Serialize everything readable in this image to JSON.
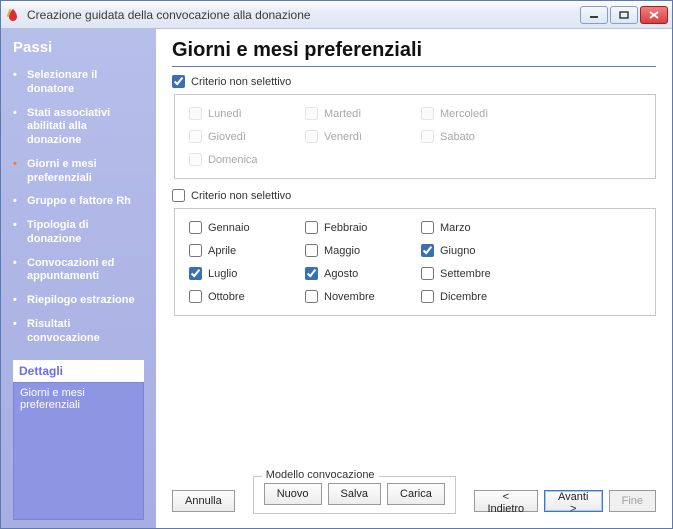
{
  "window": {
    "title": "Creazione guidata della convocazione alla donazione"
  },
  "sidebar": {
    "heading": "Passi",
    "steps": [
      "Selezionare il donatore",
      "Stati associativi abilitati alla donazione",
      "Giorni e mesi preferenziali",
      "Gruppo e fattore Rh",
      "Tipologia di donazione",
      "Convocazioni ed appuntamenti",
      "Riepilogo estrazione",
      "Risultati convocazione"
    ],
    "current_index": 2,
    "details_heading": "Dettagli",
    "details_text": "Giorni e mesi preferenziali"
  },
  "main": {
    "title": "Giorni e mesi preferenziali",
    "days_group": {
      "selective_label": "Criterio non selettivo",
      "selective_checked": true,
      "items": [
        {
          "label": "Lunedì",
          "checked": false
        },
        {
          "label": "Martedì",
          "checked": false
        },
        {
          "label": "Mercoledì",
          "checked": false
        },
        {
          "label": "Giovedì",
          "checked": false
        },
        {
          "label": "Venerdì",
          "checked": false
        },
        {
          "label": "Sabato",
          "checked": false
        },
        {
          "label": "Domenica",
          "checked": false
        }
      ]
    },
    "months_group": {
      "selective_label": "Criterio non selettivo",
      "selective_checked": false,
      "items": [
        {
          "label": "Gennaio",
          "checked": false
        },
        {
          "label": "Febbraio",
          "checked": false
        },
        {
          "label": "Marzo",
          "checked": false
        },
        {
          "label": "Aprile",
          "checked": false
        },
        {
          "label": "Maggio",
          "checked": false
        },
        {
          "label": "Giugno",
          "checked": true
        },
        {
          "label": "Luglio",
          "checked": true
        },
        {
          "label": "Agosto",
          "checked": true
        },
        {
          "label": "Settembre",
          "checked": false
        },
        {
          "label": "Ottobre",
          "checked": false
        },
        {
          "label": "Novembre",
          "checked": false
        },
        {
          "label": "Dicembre",
          "checked": false
        }
      ]
    }
  },
  "bottom": {
    "cancel": "Annulla",
    "model_legend": "Modello convocazione",
    "new": "Nuovo",
    "save": "Salva",
    "load": "Carica",
    "back": "< Indietro",
    "next": "Avanti >",
    "finish": "Fine"
  }
}
